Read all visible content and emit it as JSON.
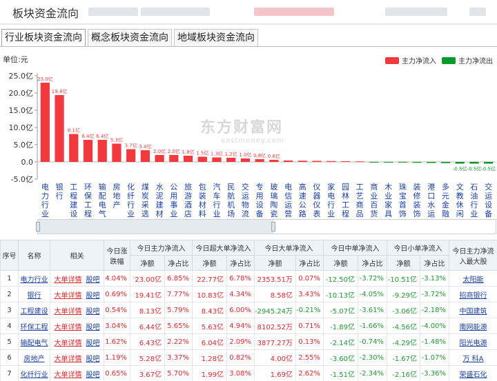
{
  "page": {
    "title": "板块资金流向"
  },
  "tabs": [
    {
      "label": "行业板块资金流向",
      "active": true
    },
    {
      "label": "概念板块资金流向",
      "active": false
    },
    {
      "label": "地域板块资金流向",
      "active": false
    }
  ],
  "colors": {
    "inflow": "#f23a3e",
    "outflow": "#0a9a2a",
    "link": "#1a3fa6"
  },
  "watermark": {
    "main": "东方财富网",
    "sub": "eastmoney.com"
  },
  "chart_data": {
    "type": "bar",
    "unit_label": "单位:元",
    "legend": [
      {
        "name": "主力净流入",
        "color": "#f23a3e"
      },
      {
        "name": "主力净流出",
        "color": "#0a9a2a"
      }
    ],
    "legend_position": "top-right",
    "ylim": [
      -5,
      25
    ],
    "yticks": [
      "25.0亿",
      "20.0亿",
      "15.0亿",
      "10.0亿",
      "5.0亿",
      "0.0",
      "-5.0亿"
    ],
    "categories": [
      "电力行业",
      "银行",
      "工程建设",
      "环保工程",
      "输配电气",
      "房地产",
      "化纤行业",
      "煤炭采选",
      "水泥建材",
      "公用事业",
      "旅游酒店",
      "包装材料",
      "汽车行业",
      "民航机场",
      "交运物流",
      "专用设备",
      "玻璃陶瓷",
      "电信运营",
      "高速公路",
      "仪器仪表",
      "家电行业",
      "园林工程",
      "工艺商品",
      "商业百货",
      "木业家具",
      "珠宝首饰",
      "装修装饰",
      "港口水运",
      "多元金融",
      "文教休闲",
      "石油行业",
      "交运设备"
    ],
    "values": [
      23.0,
      19.4,
      8.1,
      6.4,
      6.4,
      5.3,
      3.7,
      3.4,
      2.0,
      2.0,
      1.8,
      1.5,
      1.3,
      1.2,
      1.0,
      0.8,
      0.6,
      0.4,
      0.35,
      0.3,
      0.25,
      0.2,
      0.15,
      -0.1,
      -0.15,
      -0.2,
      -0.25,
      -0.3,
      -0.35,
      -0.5,
      -0.5,
      -0.5
    ],
    "data_labels": [
      "23.0亿",
      "19.4亿",
      "8.1亿",
      "6.4亿",
      "6.4亿",
      "5.3亿",
      "3.7亿",
      "3.4亿",
      "2.0亿",
      "2.0亿",
      "1.8亿",
      "1.5亿",
      "1.3亿",
      "1.2亿",
      "1.0亿",
      "0.8亿",
      "0.6亿",
      "",
      "",
      "",
      "",
      "",
      "",
      "",
      "",
      "",
      "",
      "",
      "",
      "-0.5亿",
      "-0.5亿",
      "-0.5亿"
    ],
    "grid": false
  },
  "table": {
    "headers": {
      "seq": "序号",
      "name": "名称",
      "related": "相关",
      "pct": "今日涨跌幅",
      "main": "今日主力净流入",
      "super": "今日超大单净流入",
      "big": "今日大单净流入",
      "mid": "今日中单净流入",
      "small": "今日小单净流入",
      "top": "今日主力净流入最大股",
      "amount": "净额",
      "ratio": "净占比"
    },
    "link_detail": "大单详情",
    "link_bar": "股吧",
    "rows": [
      {
        "seq": "1",
        "name": "电力行业",
        "pct": "4.04%",
        "main_amt": "23.00亿",
        "main_ratio": "6.85%",
        "super_amt": "22.77亿",
        "super_ratio": "6.78%",
        "big_amt": "2353.51万",
        "big_ratio": "0.07%",
        "mid_amt": "-12.50亿",
        "mid_ratio": "-3.72%",
        "small_amt": "-10.51亿",
        "small_ratio": "-3.13%",
        "top": "太阳能"
      },
      {
        "seq": "2",
        "name": "银行",
        "pct": "0.69%",
        "main_amt": "19.41亿",
        "main_ratio": "7.77%",
        "super_amt": "10.83亿",
        "super_ratio": "4.34%",
        "big_amt": "8.58亿",
        "big_ratio": "3.43%",
        "mid_amt": "-10.13亿",
        "mid_ratio": "-4.05%",
        "small_amt": "-9.29亿",
        "small_ratio": "-3.72%",
        "top": "招商银行"
      },
      {
        "seq": "3",
        "name": "工程建设",
        "pct": "0.54%",
        "main_amt": "8.13亿",
        "main_ratio": "5.79%",
        "super_amt": "8.43亿",
        "super_ratio": "6.00%",
        "big_amt": "-2945.24万",
        "big_ratio": "-0.21%",
        "mid_amt": "-5.07亿",
        "mid_ratio": "-3.61%",
        "small_amt": "-3.06亿",
        "small_ratio": "-2.18%",
        "top": "中国建筑"
      },
      {
        "seq": "4",
        "name": "环保工程",
        "pct": "3.04%",
        "main_amt": "6.44亿",
        "main_ratio": "5.65%",
        "super_amt": "5.63亿",
        "super_ratio": "4.94%",
        "big_amt": "8102.52万",
        "big_ratio": "0.71%",
        "mid_amt": "-1.89亿",
        "mid_ratio": "-1.66%",
        "small_amt": "-4.56亿",
        "small_ratio": "-4.00%",
        "top": "南网能源"
      },
      {
        "seq": "5",
        "name": "输配电气",
        "pct": "1.62%",
        "main_amt": "6.43亿",
        "main_ratio": "2.22%",
        "super_amt": "6.04亿",
        "super_ratio": "2.09%",
        "big_amt": "3877.27万",
        "big_ratio": "0.13%",
        "mid_amt": "-2.14亿",
        "mid_ratio": "-0.74%",
        "small_amt": "-4.29亿",
        "small_ratio": "-1.48%",
        "top": "阳光电源"
      },
      {
        "seq": "6",
        "name": "房地产",
        "pct": "1.19%",
        "main_amt": "5.28亿",
        "main_ratio": "3.37%",
        "super_amt": "1.28亿",
        "super_ratio": "0.82%",
        "big_amt": "4.00亿",
        "big_ratio": "2.55%",
        "mid_amt": "-3.60亿",
        "mid_ratio": "-2.30%",
        "small_amt": "-1.67亿",
        "small_ratio": "-1.07%",
        "top": "万 科A"
      },
      {
        "seq": "7",
        "name": "化纤行业",
        "pct": "0.65%",
        "main_amt": "3.67亿",
        "main_ratio": "5.70%",
        "super_amt": "1.99亿",
        "super_ratio": "3.08%",
        "big_amt": "1.69亿",
        "big_ratio": "2.62%",
        "mid_amt": "-1.51亿",
        "mid_ratio": "-2.34%",
        "small_amt": "-2.16亿",
        "small_ratio": "-3.36%",
        "top": "荣盛石化"
      }
    ]
  }
}
